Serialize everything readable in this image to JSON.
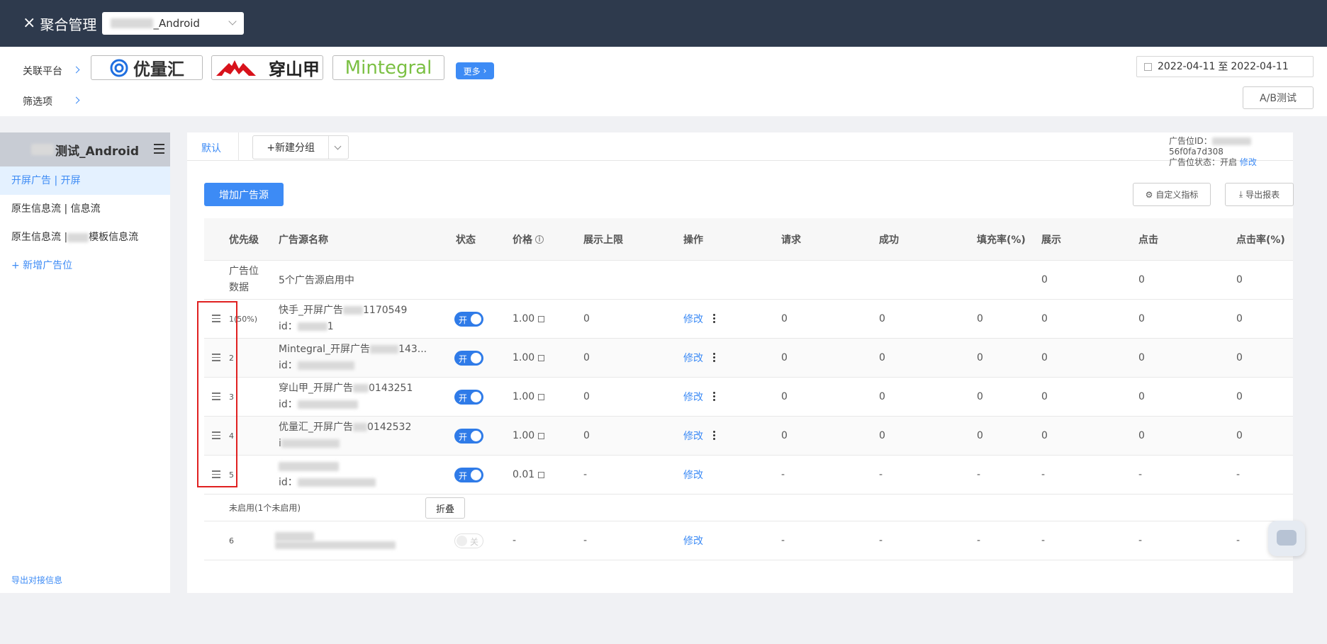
{
  "header": {
    "close_icon": "×",
    "title": "聚合管理",
    "app_select": "_Android"
  },
  "filters": {
    "platform_label": "关联平台",
    "filter_label": "筛选项",
    "platforms": [
      "优量汇",
      "穿山甲",
      "Mintegral"
    ],
    "more": "更多",
    "date_start": "2022-04-11",
    "date_to": "至",
    "date_end": "2022-04-11",
    "ab_test": "A/B测试"
  },
  "sidebar": {
    "app_name": "测试_Android",
    "items": [
      "开屏广告 | 开屏",
      "原生信息流 | 信息流",
      "原生信息流 |",
      "+ 新增广告位"
    ],
    "item3_suffix": "模板信息流",
    "export": "导出对接信息"
  },
  "main": {
    "tab_default": "默认",
    "new_group": "+新建分组",
    "adpos_id_label": "广告位ID：",
    "adpos_id_suffix": "56f0fa7d308",
    "adpos_status_label": "广告位状态：",
    "adpos_status": "开启",
    "adpos_edit": "修改",
    "add_source": "增加广告源",
    "custom_metrics": "自定义指标",
    "export_report": "导出报表"
  },
  "table": {
    "headers": [
      "优先级",
      "广告源名称",
      "状态",
      "价格",
      "展示上限",
      "操作",
      "请求",
      "成功",
      "填充率(%)",
      "展示",
      "点击",
      "点击率(%)"
    ],
    "agg": {
      "label1": "广告位",
      "label2": "数据",
      "summary": "5个广告源启用中",
      "show": "0",
      "click": "0",
      "ctr": "0"
    },
    "rows": [
      {
        "priority": "1",
        "share": "(50%)",
        "name": "快手_开屏广告",
        "name_suffix": "1170549",
        "id_label": "id：",
        "id_suffix": "1",
        "status": "开",
        "price": "1.00",
        "cap": "0",
        "op": "修改",
        "req": "0",
        "succ": "0",
        "fill": "0",
        "show": "0",
        "click": "0",
        "ctr": "0"
      },
      {
        "priority": "2",
        "share": "",
        "name": "Mintegral_开屏广告",
        "name_suffix": "143...",
        "id_label": "id：",
        "id_suffix": "",
        "status": "开",
        "price": "1.00",
        "cap": "0",
        "op": "修改",
        "req": "0",
        "succ": "0",
        "fill": "0",
        "show": "0",
        "click": "0",
        "ctr": "0"
      },
      {
        "priority": "3",
        "share": "",
        "name": "穿山甲_开屏广告",
        "name_suffix": "0143251",
        "id_label": "id：",
        "id_suffix": "",
        "status": "开",
        "price": "1.00",
        "cap": "0",
        "op": "修改",
        "req": "0",
        "succ": "0",
        "fill": "0",
        "show": "0",
        "click": "0",
        "ctr": "0"
      },
      {
        "priority": "4",
        "share": "",
        "name": "优量汇_开屏广告",
        "name_suffix": "0142532",
        "id_label": "i",
        "id_suffix": "",
        "status": "开",
        "price": "1.00",
        "cap": "0",
        "op": "修改",
        "req": "0",
        "succ": "0",
        "fill": "0",
        "show": "0",
        "click": "0",
        "ctr": "0"
      },
      {
        "priority": "5",
        "share": "",
        "name": "",
        "name_suffix": "",
        "id_label": "id：",
        "id_suffix": "",
        "status": "开",
        "price": "0.01",
        "cap": "-",
        "op": "修改",
        "req": "-",
        "succ": "-",
        "fill": "-",
        "show": "-",
        "click": "-",
        "ctr": "-"
      }
    ],
    "unused_label": "未启用(1个未启用)",
    "fold": "折叠",
    "disabled_row": {
      "priority": "6",
      "status": "关",
      "price": "-",
      "cap": "-",
      "op": "修改",
      "req": "-",
      "succ": "-",
      "fill": "-",
      "show": "-",
      "click": "-",
      "ctr": "-"
    }
  },
  "colors": {
    "topbar": "#2e3a4d",
    "accent": "#3d8bf5",
    "toggle_on": "#2f7be8",
    "highlight": "#e02020"
  }
}
